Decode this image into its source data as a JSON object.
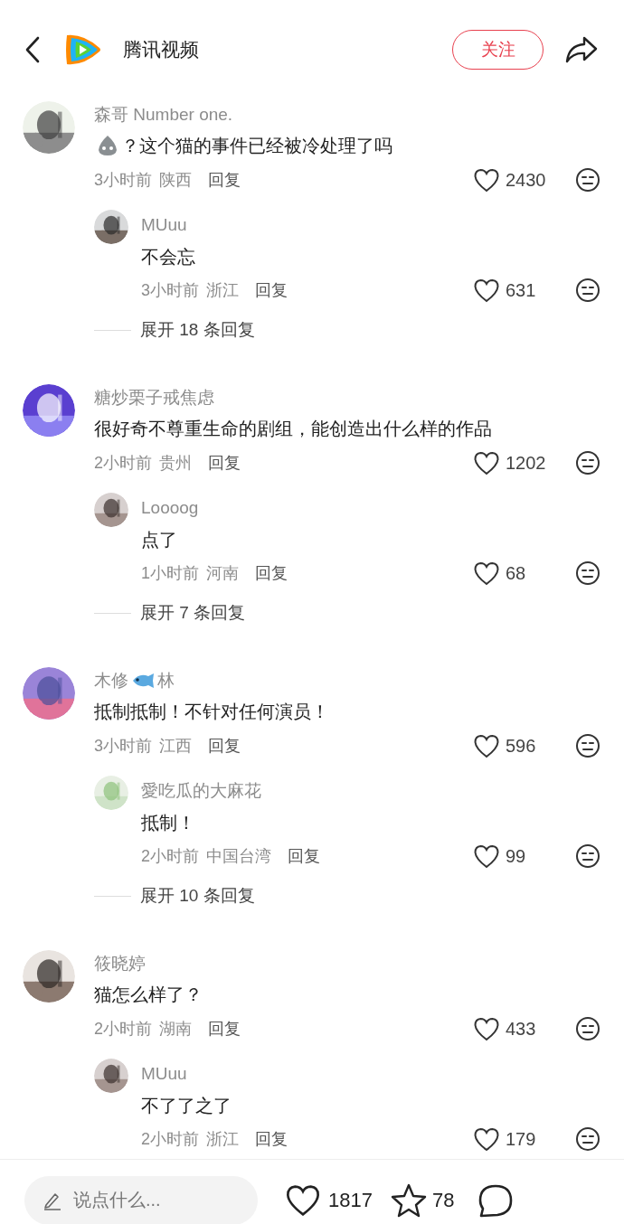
{
  "header": {
    "title": "腾讯视频",
    "follow_button": "关注"
  },
  "threads": [
    {
      "comment": {
        "name": [
          {
            "kind": "text",
            "text": "森哥 Number one."
          }
        ],
        "text": [
          {
            "kind": "emoji"
          },
          {
            "kind": "text",
            "text": "？这个猫的事件已经被冷处理了吗"
          }
        ],
        "time": "3小时前",
        "location": "陕西",
        "reply_label": "回复",
        "likes": "2430"
      },
      "reply": {
        "name": [
          {
            "kind": "text",
            "text": "MUuu"
          }
        ],
        "text": [
          {
            "kind": "text",
            "text": "不会忘"
          }
        ],
        "time": "3小时前",
        "location": "浙江",
        "reply_label": "回复",
        "likes": "631"
      },
      "expand": "展开 18 条回复"
    },
    {
      "comment": {
        "name": [
          {
            "kind": "text",
            "text": "糖炒栗子戒焦虑"
          }
        ],
        "text": [
          {
            "kind": "text",
            "text": "很好奇不尊重生命的剧组，能创造出什么样的作品"
          }
        ],
        "time": "2小时前",
        "location": "贵州",
        "reply_label": "回复",
        "likes": "1202"
      },
      "reply": {
        "name": [
          {
            "kind": "text",
            "text": "Loooog"
          }
        ],
        "text": [
          {
            "kind": "text",
            "text": "点了"
          }
        ],
        "time": "1小时前",
        "location": "河南",
        "reply_label": "回复",
        "likes": "68"
      },
      "expand": "展开 7 条回复"
    },
    {
      "comment": {
        "name": [
          {
            "kind": "text",
            "text": "木修"
          },
          {
            "kind": "emoji"
          },
          {
            "kind": "text",
            "text": "林"
          }
        ],
        "text": [
          {
            "kind": "text",
            "text": "抵制抵制！不针对任何演员！"
          }
        ],
        "time": "3小时前",
        "location": "江西",
        "reply_label": "回复",
        "likes": "596"
      },
      "reply": {
        "name": [
          {
            "kind": "text",
            "text": "愛吃瓜的大麻花"
          }
        ],
        "text": [
          {
            "kind": "text",
            "text": "抵制！"
          }
        ],
        "time": "2小时前",
        "location": "中国台湾",
        "reply_label": "回复",
        "likes": "99"
      },
      "expand": "展开 10 条回复"
    },
    {
      "comment": {
        "name": [
          {
            "kind": "text",
            "text": "筱晓婷"
          }
        ],
        "text": [
          {
            "kind": "text",
            "text": "猫怎么样了？"
          }
        ],
        "time": "2小时前",
        "location": "湖南",
        "reply_label": "回复",
        "likes": "433"
      },
      "reply": {
        "name": [
          {
            "kind": "text",
            "text": "MUuu"
          }
        ],
        "text": [
          {
            "kind": "text",
            "text": "不了了之了"
          }
        ],
        "time": "2小时前",
        "location": "浙江",
        "reply_label": "回复",
        "likes": "179"
      }
    }
  ],
  "bottom_bar": {
    "placeholder": "说点什么...",
    "likes": "1817",
    "favorites": "78"
  }
}
